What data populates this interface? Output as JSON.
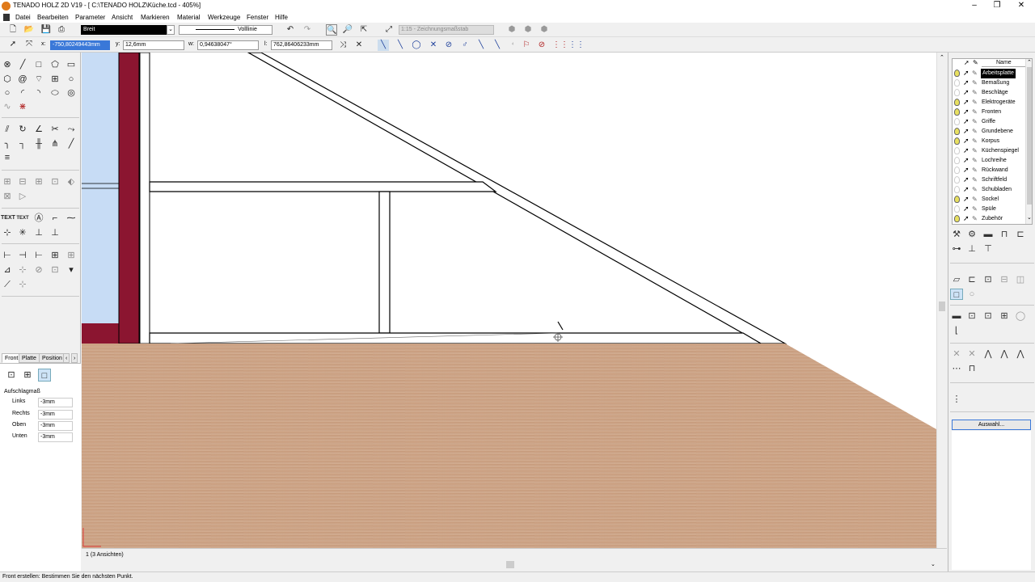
{
  "window": {
    "title": "TENADO HOLZ 2D V19 - [ C:\\TENADO HOLZ\\Küche.tcd - 405%]",
    "minimize": "–",
    "restore": "❐",
    "close": "✕"
  },
  "menu": [
    "Datei",
    "Bearbeiten",
    "Parameter",
    "Ansicht",
    "Markieren",
    "Material",
    "Werkzeuge",
    "Fenster",
    "Hilfe"
  ],
  "toolbar1": {
    "pen_select": "Breit",
    "line_type": "Volllinie",
    "scale": "1:15 - Zeichnungsmaßstab"
  },
  "coords": {
    "x_label": "x:",
    "x_value": "-750,80249443mm",
    "y_label": "y:",
    "y_value": "12,6mm",
    "w_label": "w:",
    "w_value": "0,94638047°",
    "l_label": "l:",
    "l_value": "762,86406233mm"
  },
  "left_tabs": [
    "Front",
    "Platte",
    "Position"
  ],
  "aufschlag": {
    "title": "Aufschlagmaß",
    "rows": [
      {
        "label": "Links",
        "value": "-3mm"
      },
      {
        "label": "Rechts",
        "value": "-3mm"
      },
      {
        "label": "Oben",
        "value": "-3mm"
      },
      {
        "label": "Unten",
        "value": "-3mm"
      }
    ]
  },
  "layers": {
    "header": "Name",
    "items": [
      {
        "name": "Arbeitsplatte",
        "on": true,
        "selected": true
      },
      {
        "name": "Bemaßung",
        "on": false
      },
      {
        "name": "Beschläge",
        "on": false
      },
      {
        "name": "Elektrogeräte",
        "on": true
      },
      {
        "name": "Fronten",
        "on": true
      },
      {
        "name": "Griffe",
        "on": false
      },
      {
        "name": "Grundebene",
        "on": true
      },
      {
        "name": "Korpus",
        "on": true
      },
      {
        "name": "Küchenspiegel",
        "on": false
      },
      {
        "name": "Lochreihe",
        "on": false
      },
      {
        "name": "Rückwand",
        "on": false
      },
      {
        "name": "Schriftfeld",
        "on": false
      },
      {
        "name": "Schubladen",
        "on": false
      },
      {
        "name": "Sockel",
        "on": true
      },
      {
        "name": "Spüle",
        "on": false
      },
      {
        "name": "Zubehör",
        "on": true
      }
    ]
  },
  "auswahl_button": "Auswahl...",
  "view_tab": "1 (3 Ansichten)",
  "status": "Front erstellen: Bestimmen Sie den nächsten Punkt.",
  "colors": {
    "accent_blue": "#c7dcf5",
    "cabinet_red": "#8b1530",
    "wood": "#c9a084",
    "bulb_on": "#e8e060"
  }
}
